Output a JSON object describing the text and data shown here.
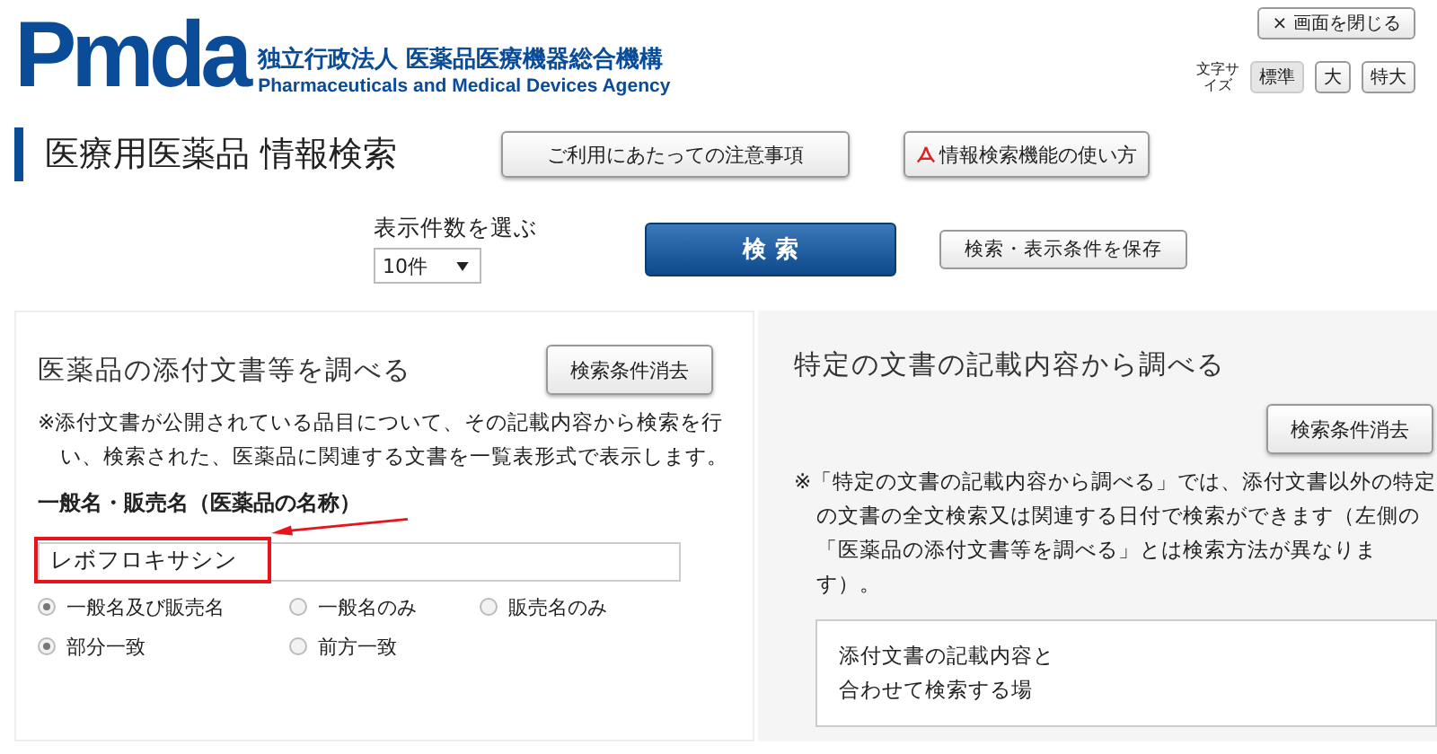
{
  "logo": {
    "mark": "Pmda",
    "org_ja": "独立行政法人 医薬品医療機器総合機構",
    "org_en": "Pharmaceuticals and Medical Devices Agency"
  },
  "close_button": "× 画面を閉じる",
  "font_size": {
    "label": "文字サイズ",
    "options": [
      {
        "label": "標準",
        "selected": true
      },
      {
        "label": "大",
        "selected": false
      },
      {
        "label": "特大",
        "selected": false
      }
    ]
  },
  "page_title": "医療用医薬品 情報検索",
  "header_buttons": [
    {
      "label": "ご利用にあたっての注意事項",
      "kind": "plain"
    },
    {
      "label": "情報検索機能の使い方",
      "kind": "pdf"
    }
  ],
  "display_count": {
    "label": "表示件数を選ぶ",
    "value": "10件"
  },
  "search_button": "検 索",
  "save_button": "検索・表示条件を保存",
  "left_panel": {
    "title": "医薬品の添付文書等を調べる",
    "clear_button": "検索条件消去",
    "note": "※添付文書が公開されている品目について、その記載内容から検索を行い、検索された、医薬品に関連する文書を一覧表形式で表示します。",
    "field_label": "一般名・販売名（医薬品の名称）",
    "field_value": "レボフロキサシン",
    "name_options": [
      {
        "label": "一般名及び販売名",
        "selected": true
      },
      {
        "label": "一般名のみ",
        "selected": false
      },
      {
        "label": "販売名のみ",
        "selected": false
      }
    ],
    "match_options": [
      {
        "label": "部分一致",
        "selected": true
      },
      {
        "label": "前方一致",
        "selected": false
      }
    ]
  },
  "right_panel": {
    "title": "特定の文書の記載内容から調べる",
    "clear_button": "検索条件消去",
    "note": "※「特定の文書の記載内容から調べる」では、添付文書以外の特定の文書の全文検索又は関連する日付で検索ができます（左側の「医薬品の添付文書等を調べる」とは検索方法が異なります）。",
    "box_text": "添付文書の記載内容と合わせて検索する場"
  }
}
